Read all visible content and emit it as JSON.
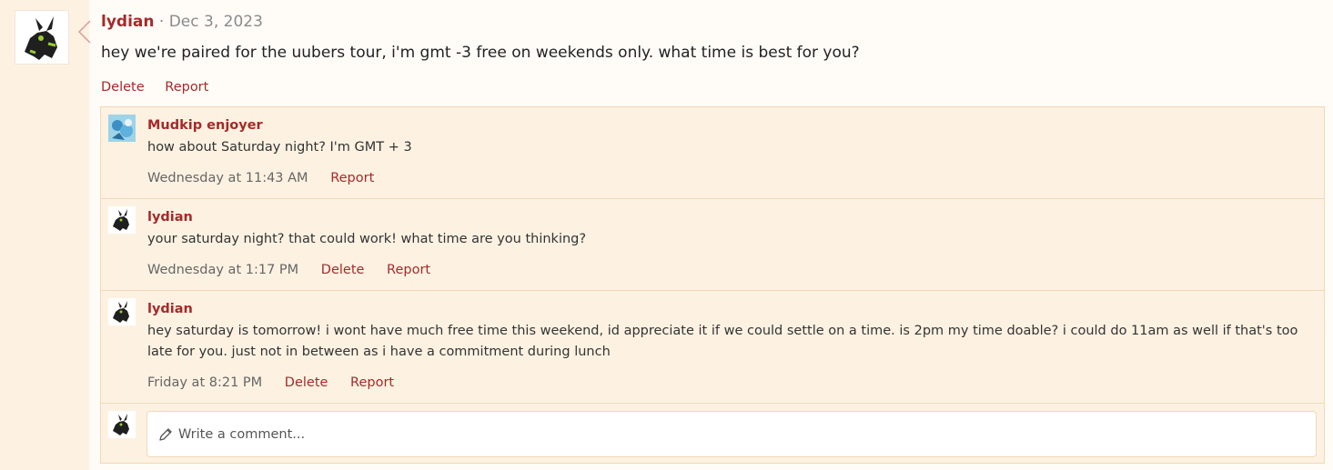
{
  "post": {
    "avatar_icon": "umbreon-like-avatar",
    "author": "lydian",
    "separator": "·",
    "date": "Dec 3, 2023",
    "body": "hey we're paired for the uubers tour, i'm gmt -3 free on weekends only. what time is best for you?",
    "actions": {
      "delete": "Delete",
      "report": "Report"
    }
  },
  "comments": [
    {
      "avatar_icon": "mudkip-avatar",
      "author": "Mudkip enjoyer",
      "text": "how about Saturday night? I'm GMT + 3",
      "time": "Wednesday at 11:43 AM",
      "report": "Report"
    },
    {
      "avatar_icon": "umbreon-like-avatar",
      "author": "lydian",
      "text": "your saturday night? that could work! what time are you thinking?",
      "time": "Wednesday at 1:17 PM",
      "delete": "Delete",
      "report": "Report"
    },
    {
      "avatar_icon": "umbreon-like-avatar",
      "author": "lydian",
      "text": "hey saturday is tomorrow! i wont have much free time this weekend, id appreciate it if we could settle on a time. is 2pm my time doable? i could do 11am as well if that's too late for you. just not in between as i have a commitment during lunch",
      "time": "Friday at 8:21 PM",
      "delete": "Delete",
      "report": "Report"
    }
  ],
  "comment_input": {
    "placeholder": "Write a comment...",
    "icon": "pencil-icon"
  },
  "colors": {
    "accent": "#a52a2a",
    "panel_bg": "#fffcf8",
    "comments_bg": "#fdf2e2",
    "border": "#f0d9b5"
  }
}
